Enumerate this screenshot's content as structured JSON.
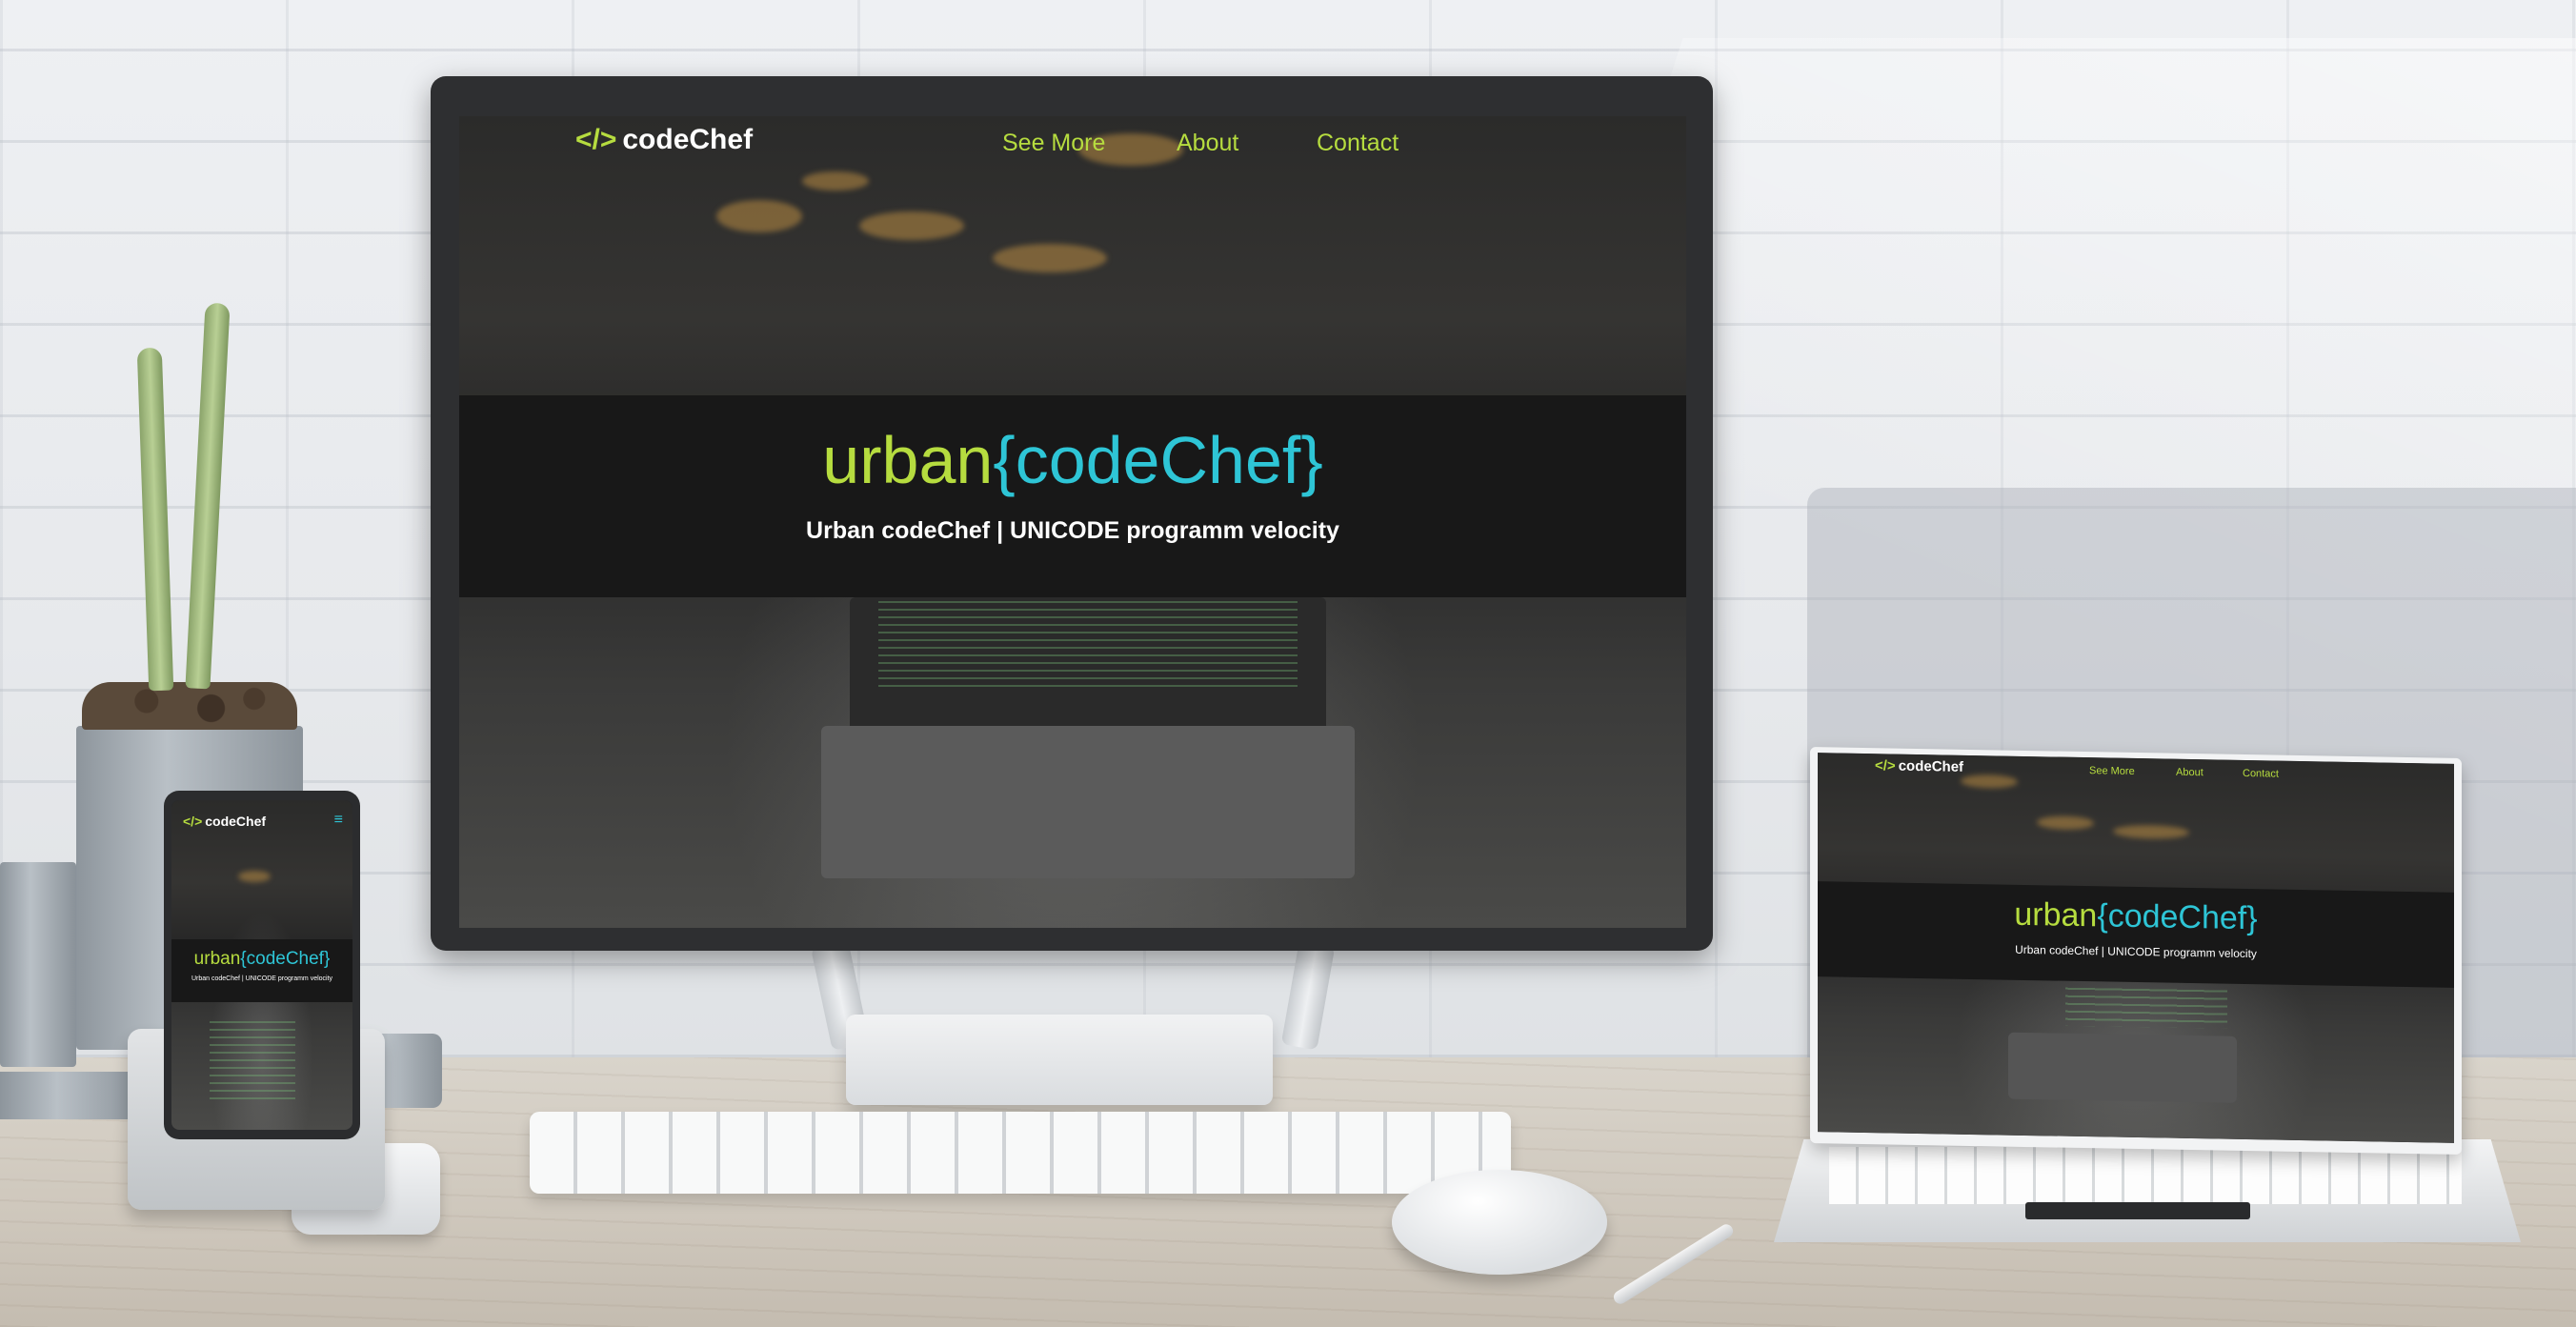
{
  "site": {
    "brand_glyph": "</>",
    "brand_name": "codeChef",
    "nav": [
      "See More",
      "About",
      "Contact"
    ],
    "menu_glyph": "≡",
    "hero_title_prefix": "urban",
    "hero_title_main": "{codeChef}",
    "hero_subtitle": "Urban codeChef | UNICODE programm velocity"
  },
  "colors": {
    "accent_lime": "#b6dc3f",
    "accent_cyan": "#2ec5d6",
    "hero_band": "#181818",
    "text_white": "#ffffff"
  }
}
